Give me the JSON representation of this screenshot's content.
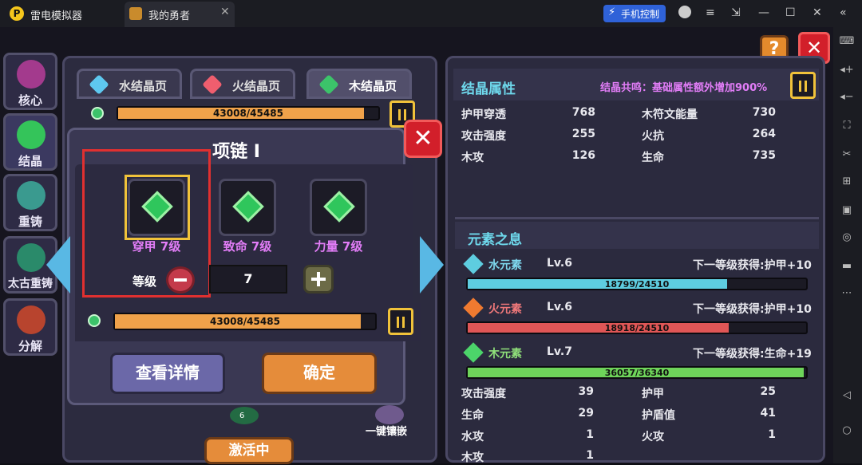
{
  "emulator": {
    "app_name": "雷电模拟器",
    "tab_title": "我的勇者",
    "phone_control": "手机控制"
  },
  "nav": [
    {
      "label": "核心"
    },
    {
      "label": "结晶"
    },
    {
      "label": "重铸"
    },
    {
      "label": "太古重铸"
    },
    {
      "label": "分解"
    }
  ],
  "tabs": [
    {
      "label": "水结晶页"
    },
    {
      "label": "火结晶页"
    },
    {
      "label": "木结晶页"
    }
  ],
  "top_bar": {
    "text": "43008/45485",
    "progress": 0.946
  },
  "modal": {
    "title": "项链 I",
    "slots": [
      {
        "label": "穿甲 7级"
      },
      {
        "label": "致命 7级"
      },
      {
        "label": "力量 7级"
      }
    ],
    "level_label": "等级",
    "level_value": "7",
    "bar_text": "43008/45485",
    "bar_progress": 0.946,
    "detail_button": "查看详情",
    "confirm_button": "确定"
  },
  "crystal_attr": {
    "title": "结晶属性",
    "resonance": "结晶共鸣：基础属性额外增加900%",
    "rows": [
      {
        "k1": "护甲穿透",
        "v1": "768",
        "k2": "木符文能量",
        "v2": "730"
      },
      {
        "k1": "攻击强度",
        "v1": "255",
        "k2": "火抗",
        "v2": "264"
      },
      {
        "k1": "木攻",
        "v1": "126",
        "k2": "生命",
        "v2": "735"
      }
    ]
  },
  "elements": {
    "title": "元素之息",
    "items": [
      {
        "name": "水元素",
        "level": "Lv.6",
        "next": "下一等级获得:护甲+10",
        "bar": "18799/24510",
        "progress": 0.767,
        "color": "#5ecde0"
      },
      {
        "name": "火元素",
        "level": "Lv.6",
        "next": "下一等级获得:护甲+10",
        "bar": "18918/24510",
        "progress": 0.772,
        "color": "#e05656"
      },
      {
        "name": "木元素",
        "level": "Lv.7",
        "next": "下一等级获得:生命+19",
        "bar": "36057/36340",
        "progress": 0.992,
        "color": "#6ed45a"
      }
    ],
    "stats": [
      {
        "k1": "攻击强度",
        "v1": "39",
        "k2": "护甲",
        "v2": "25"
      },
      {
        "k1": "生命",
        "v1": "29",
        "k2": "护盾值",
        "v2": "41"
      },
      {
        "k1": "水攻",
        "v1": "1",
        "k2": "火攻",
        "v2": "1"
      },
      {
        "k1": "木攻",
        "v1": "1",
        "k2": "",
        "v2": ""
      }
    ]
  },
  "bottom": {
    "activate": "激活中",
    "embed": "一键镶嵌",
    "count": "6"
  },
  "colors": {
    "accent_orange": "#e58c3a",
    "close_red": "#d21f2a",
    "label_purple": "#e27df7",
    "title_cyan": "#6ed8ec"
  }
}
